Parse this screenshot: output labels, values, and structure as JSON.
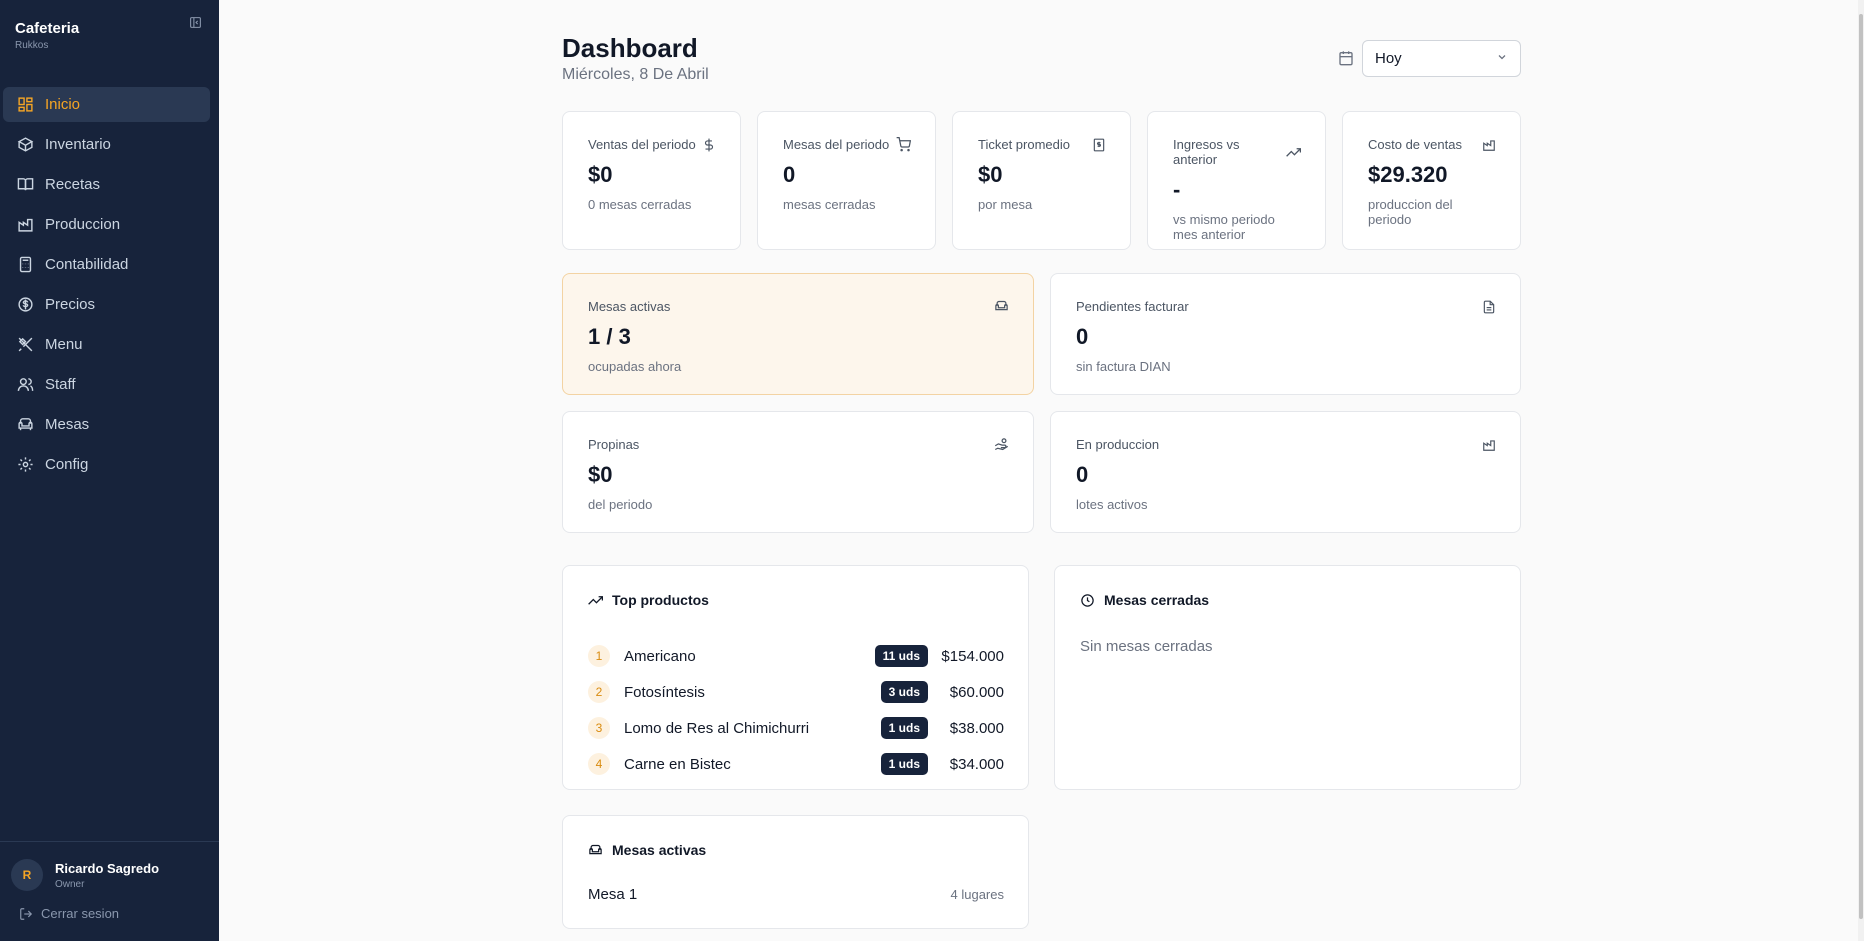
{
  "sidebar": {
    "brand_title": "Cafeteria",
    "brand_sub": "Rukkos",
    "items": [
      {
        "label": "Inicio",
        "icon": "dashboard-icon",
        "active": true
      },
      {
        "label": "Inventario",
        "icon": "box-icon"
      },
      {
        "label": "Recetas",
        "icon": "book-icon"
      },
      {
        "label": "Produccion",
        "icon": "factory-icon"
      },
      {
        "label": "Contabilidad",
        "icon": "calculator-icon"
      },
      {
        "label": "Precios",
        "icon": "dollar-circle-icon"
      },
      {
        "label": "Menu",
        "icon": "utensils-icon"
      },
      {
        "label": "Staff",
        "icon": "users-icon"
      },
      {
        "label": "Mesas",
        "icon": "table-icon"
      },
      {
        "label": "Config",
        "icon": "gear-icon"
      }
    ],
    "user": {
      "initial": "R",
      "name": "Ricardo Sagredo",
      "role": "Owner"
    },
    "logout_label": "Cerrar sesion"
  },
  "header": {
    "title": "Dashboard",
    "date": "Miércoles, 8 De Abril",
    "period_select": "Hoy"
  },
  "stats": [
    {
      "label": "Ventas del periodo",
      "value": "$0",
      "sub": "0 mesas cerradas",
      "icon": "dollar-icon"
    },
    {
      "label": "Mesas del periodo",
      "value": "0",
      "sub": "mesas cerradas",
      "icon": "cart-icon"
    },
    {
      "label": "Ticket promedio",
      "value": "$0",
      "sub": "por mesa",
      "icon": "receipt-icon"
    },
    {
      "label": "Ingresos vs anterior",
      "value": "-",
      "sub": "vs mismo periodo mes anterior",
      "icon": "trend-up-icon"
    },
    {
      "label": "Costo de ventas",
      "value": "$29.320",
      "sub": "produccion del periodo",
      "icon": "factory-icon"
    }
  ],
  "wide_stats": [
    {
      "label": "Mesas activas",
      "value": "1 / 3",
      "sub": "ocupadas ahora",
      "icon": "sofa-icon"
    },
    {
      "label": "Pendientes facturar",
      "value": "0",
      "sub": "sin factura DIAN",
      "icon": "file-icon"
    },
    {
      "label": "Propinas",
      "value": "$0",
      "sub": "del periodo",
      "icon": "tip-hand-icon"
    },
    {
      "label": "En produccion",
      "value": "0",
      "sub": "lotes activos",
      "icon": "factory-icon"
    }
  ],
  "top_products": {
    "title": "Top productos",
    "items": [
      {
        "rank": "1",
        "name": "Americano",
        "qty": "11 uds",
        "amount": "$154.000"
      },
      {
        "rank": "2",
        "name": "Fotosíntesis",
        "qty": "3 uds",
        "amount": "$60.000"
      },
      {
        "rank": "3",
        "name": "Lomo de Res al Chimichurri",
        "qty": "1 uds",
        "amount": "$38.000"
      },
      {
        "rank": "4",
        "name": "Carne en Bistec",
        "qty": "1 uds",
        "amount": "$34.000"
      }
    ]
  },
  "closed_tables": {
    "title": "Mesas cerradas",
    "empty": "Sin mesas cerradas"
  },
  "active_tables": {
    "title": "Mesas activas",
    "items": [
      {
        "name": "Mesa 1",
        "seats": "4 lugares"
      }
    ]
  },
  "colors": {
    "sidebar_bg": "#17233b",
    "accent": "#f5a524",
    "highlight_bg": "#fdf6ec"
  }
}
